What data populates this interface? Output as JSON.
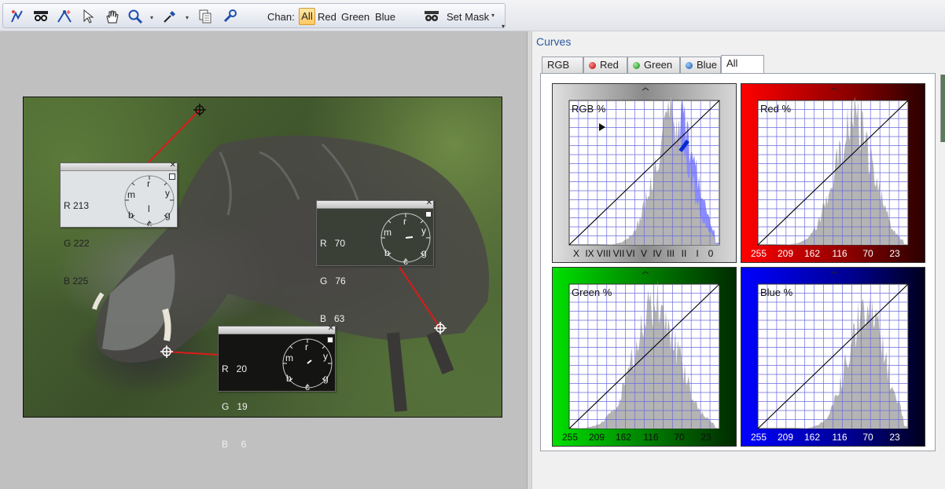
{
  "toolbar": {
    "chan_label": "Chan:",
    "channels": [
      "All",
      "Red",
      "Green",
      "Blue"
    ],
    "set_mask_label": "Set Mask"
  },
  "samples": [
    {
      "r": "R 213",
      "g": "G 222",
      "b": "B 225",
      "dial": [
        "r",
        "y",
        "g",
        "c",
        "b",
        "m",
        "l"
      ]
    },
    {
      "r": "R   70",
      "g": "G   76",
      "b": "B   63",
      "dial": [
        "r",
        "y",
        "g",
        "c",
        "b",
        "m"
      ]
    },
    {
      "r": "R   20",
      "g": "G   19",
      "b": "B     6",
      "dial": [
        "r",
        "y",
        "g",
        "c",
        "b",
        "m"
      ]
    }
  ],
  "curves": {
    "title": "Curves",
    "tabs": [
      "RGB",
      "Red",
      "Green",
      "Blue",
      "All"
    ],
    "active_tab": "All",
    "graphs": [
      {
        "label": "RGB %",
        "ticks": [
          "X",
          "IX",
          "VIII",
          "VII",
          "VI",
          "V",
          "IV",
          "III",
          "II",
          "I",
          "0"
        ]
      },
      {
        "label": "Red %",
        "ticks": [
          "255",
          "209",
          "162",
          "116",
          "70",
          "23"
        ]
      },
      {
        "label": "Green %",
        "ticks": [
          "255",
          "209",
          "162",
          "116",
          "70",
          "23"
        ]
      },
      {
        "label": "Blue %",
        "ticks": [
          "255",
          "209",
          "162",
          "116",
          "70",
          "23"
        ]
      }
    ]
  },
  "colors": {
    "accent_orange": "#ffc860",
    "red_frame": "#b00000",
    "green_frame": "#008800",
    "blue_frame": "#000090",
    "histogram": "#b4b4b4",
    "histogram_rgb_blue": "#8a8cff"
  }
}
